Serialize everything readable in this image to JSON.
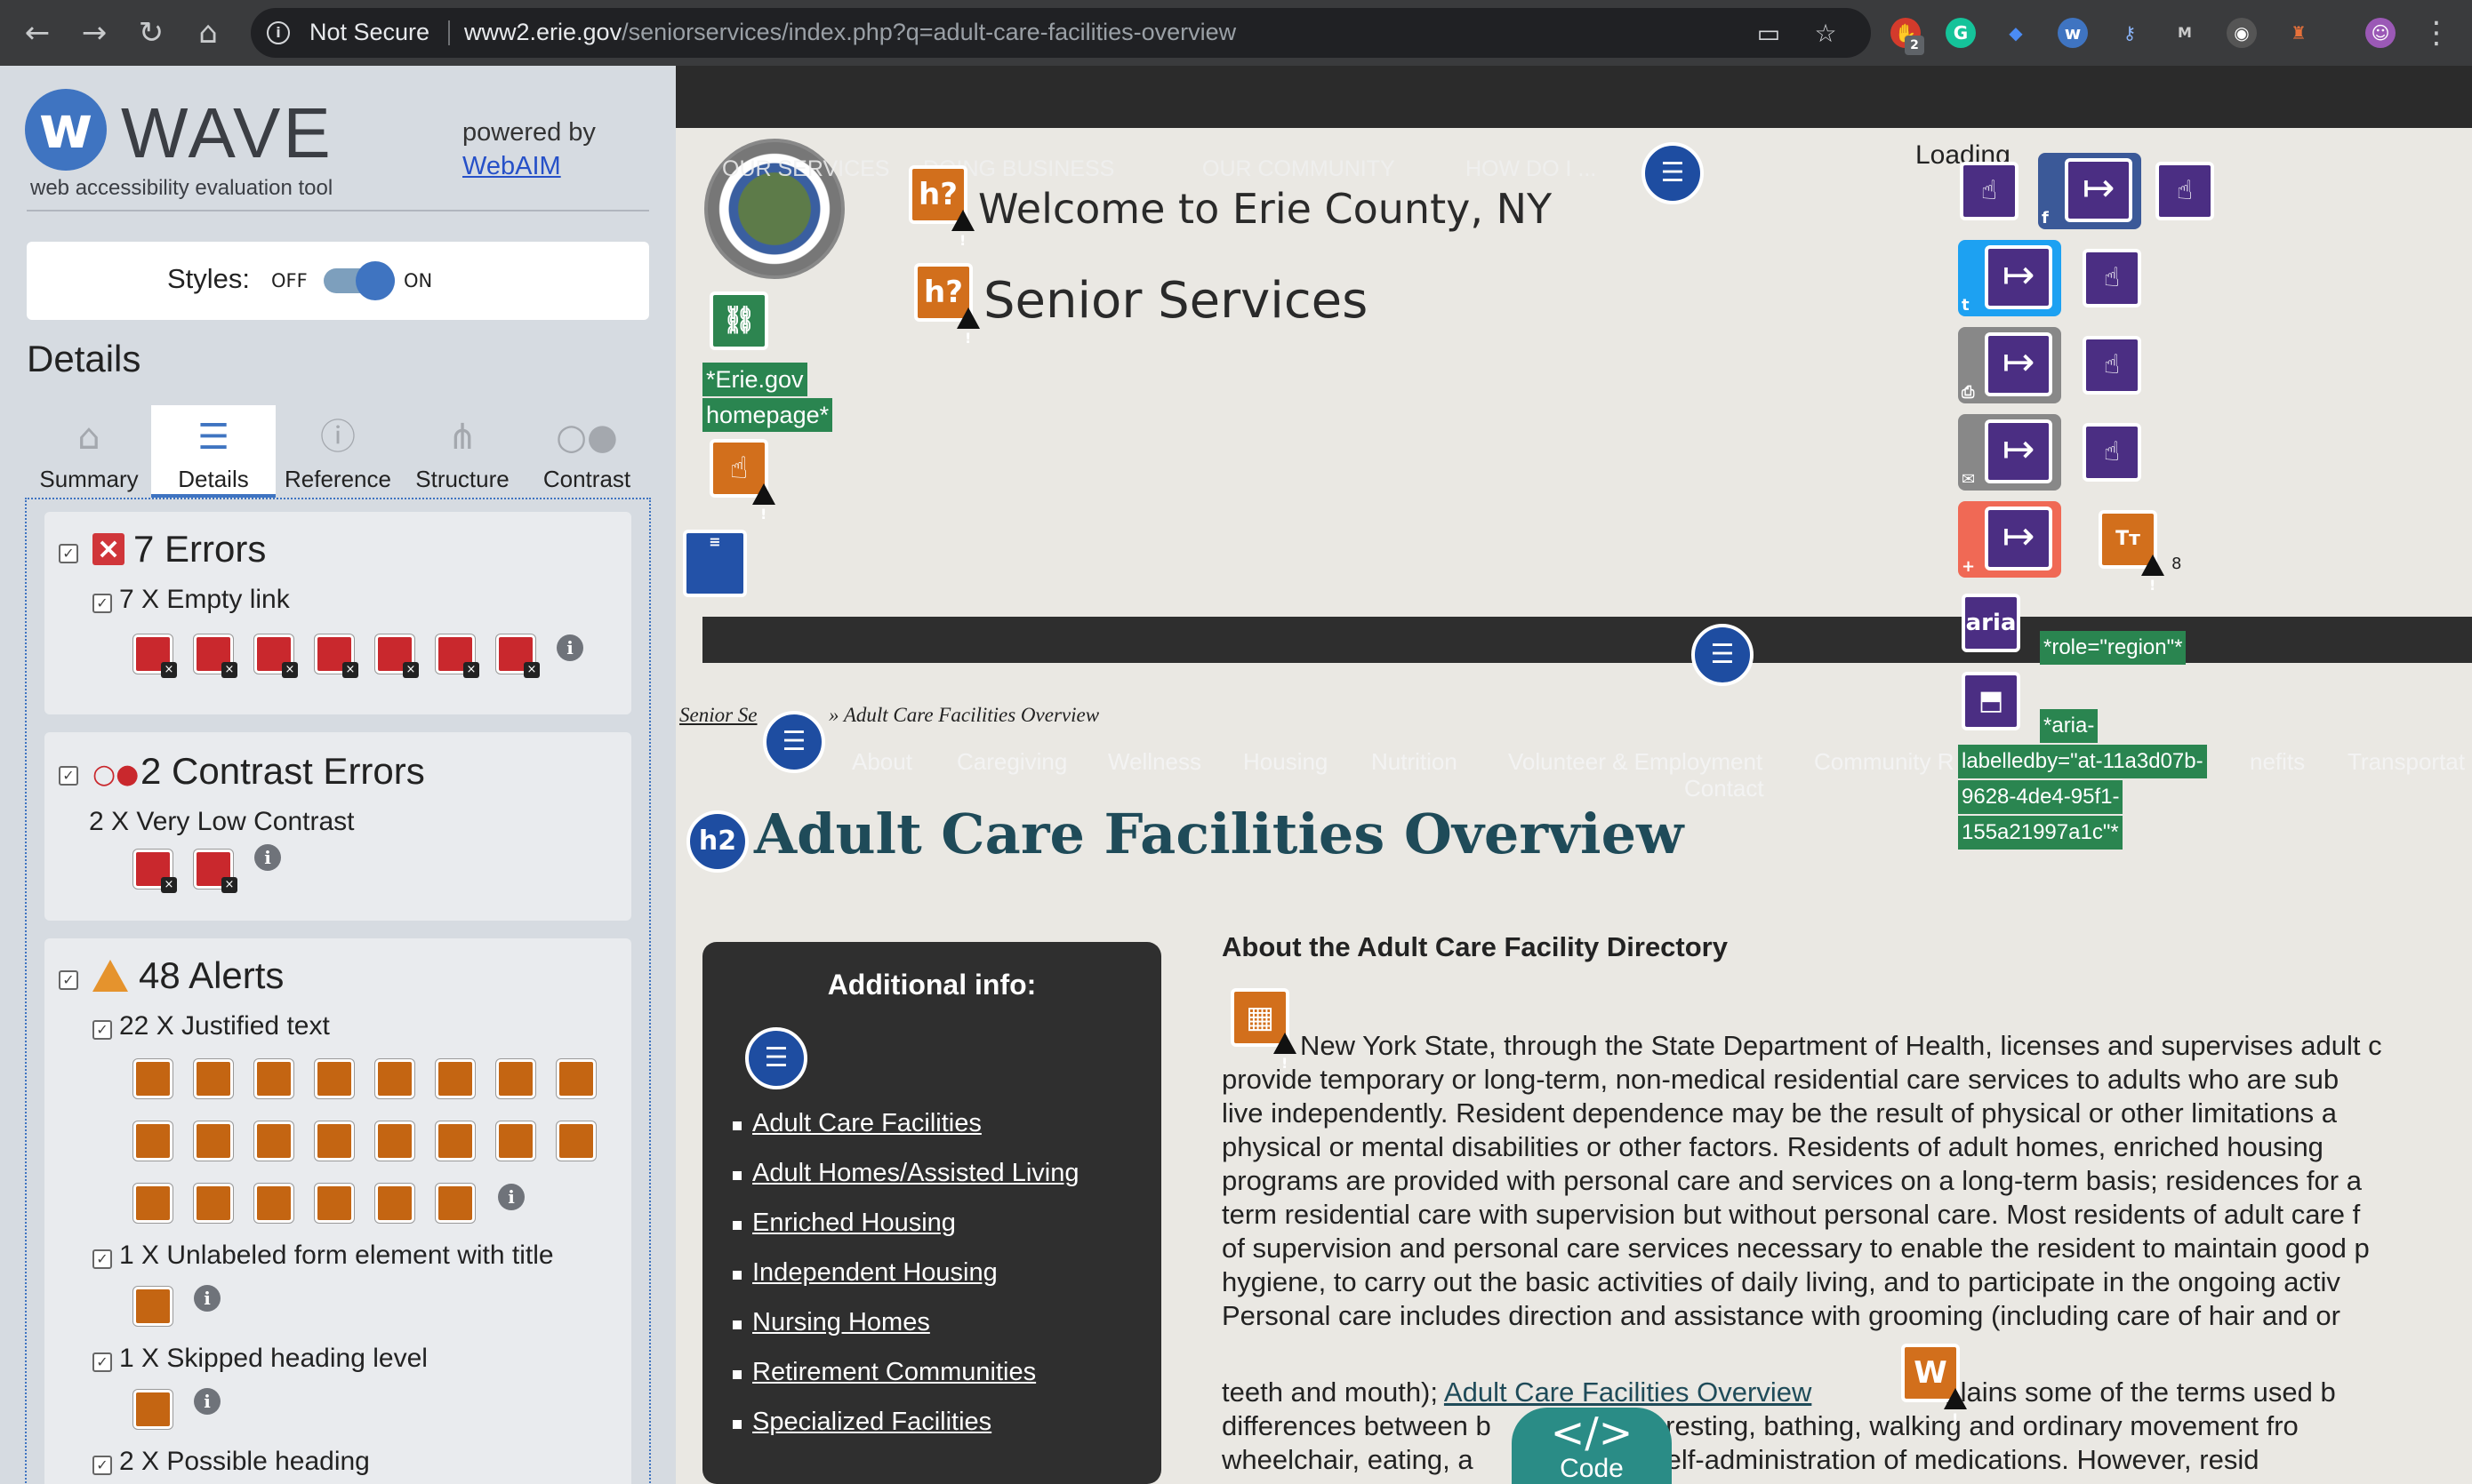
{
  "browser": {
    "secure_label": "Not Secure",
    "url_host": "www2.erie.gov",
    "url_path": "/seniorservices/index.php?q=adult-care-facilities-overview",
    "back_icon": "back-arrow-icon",
    "forward_icon": "forward-arrow-icon",
    "reload_icon": "reload-icon",
    "home_icon": "home-icon",
    "ext_badge": "2"
  },
  "wave": {
    "title": "WAVE",
    "subtitle": "web accessibility evaluation tool",
    "powered_by": "powered by",
    "webaim": "WebAIM",
    "styles_label": "Styles:",
    "styles_off": "OFF",
    "styles_on": "ON",
    "details_heading": "Details",
    "tabs": [
      {
        "label": "Summary",
        "icon": "home-icon"
      },
      {
        "label": "Details",
        "icon": "list-icon"
      },
      {
        "label": "Reference",
        "icon": "info-icon"
      },
      {
        "label": "Structure",
        "icon": "hierarchy-icon"
      },
      {
        "label": "Contrast",
        "icon": "contrast-icon"
      }
    ],
    "errors": {
      "title": "7 Errors",
      "item": "7 X Empty link"
    },
    "contrast": {
      "title": "2 Contrast Errors",
      "item": "2 X Very Low Contrast"
    },
    "alerts": {
      "title": "48 Alerts",
      "items": [
        "22 X Justified text",
        "1 X Unlabeled form element with title",
        "1 X Skipped heading level",
        "2 X Possible heading"
      ]
    }
  },
  "page": {
    "topnav": [
      "OUR SERVICES",
      "DOING BUSINESS",
      "OUR COMMUNITY",
      "HOW DO I ..."
    ],
    "erie_label_1": "*Erie.gov",
    "erie_label_2": "homepage*",
    "welcome": "Welcome to Erie County, NY",
    "senior": "Senior Services",
    "loading": "Loading",
    "tt_count": "8",
    "aria_label": "aria",
    "role_region": "*role=\"region\"*",
    "aria_labelledby": [
      "*aria-",
      "labelledby=\"at-11a3d07b-",
      "9628-4de4-95f1-",
      "155a21997a1c\"*"
    ],
    "breadcrumb_link": "Senior Se",
    "breadcrumb_rest": "» Adult Care Facilities Overview",
    "subnav": [
      "About",
      "Caregiving",
      "Wellness",
      "Housing",
      "Nutrition",
      "Volunteer & Employment",
      "Contact",
      "Community R",
      "nefits",
      "Transportat"
    ],
    "h2_badge": "h2",
    "h1": "Adult Care Facilities Overview",
    "additional_title": "Additional info:",
    "links": [
      "Adult Care Facilities",
      "Adult Homes/Assisted Living",
      "Enriched Housing",
      "Independent Housing",
      "Nursing Homes",
      "Retirement Communities",
      "Specialized Facilities"
    ],
    "about_heading": "About the Adult Care Facility Directory",
    "body_lines": [
      "New York State, through the State Department of Health, licenses and supervises adult c",
      "provide temporary or long-term, non-medical residential care services to adults who are sub",
      "live independently. Resident dependence may be the result of physical or other limitations a",
      "physical or mental disabilities or other factors. Residents of adult homes, enriched housing",
      "programs are provided with personal care and services on a long-term basis; residences for a",
      "term residential care with supervision but without personal care. Most residents of adult care f",
      "of supervision and personal care services necessary to enable the resident to maintain good p",
      "hygiene, to carry out the basic activities of daily living, and to participate in the ongoing activ",
      "Personal care includes direction and assistance with grooming (including care of hair and or"
    ],
    "body2_prefix": "teeth and mouth);",
    "body2_link": "Adult Care Facilities Overview",
    "body2_suffix": "explains some of the terms used b",
    "body2_line2": "differences between b          ations - resting, bathing, walking and ordinary movement fro",
    "body2_line3": "wheelchair, eating, a                with self-administration of medications. However, resid",
    "code_label": "Code",
    "code_icon": "</>"
  }
}
